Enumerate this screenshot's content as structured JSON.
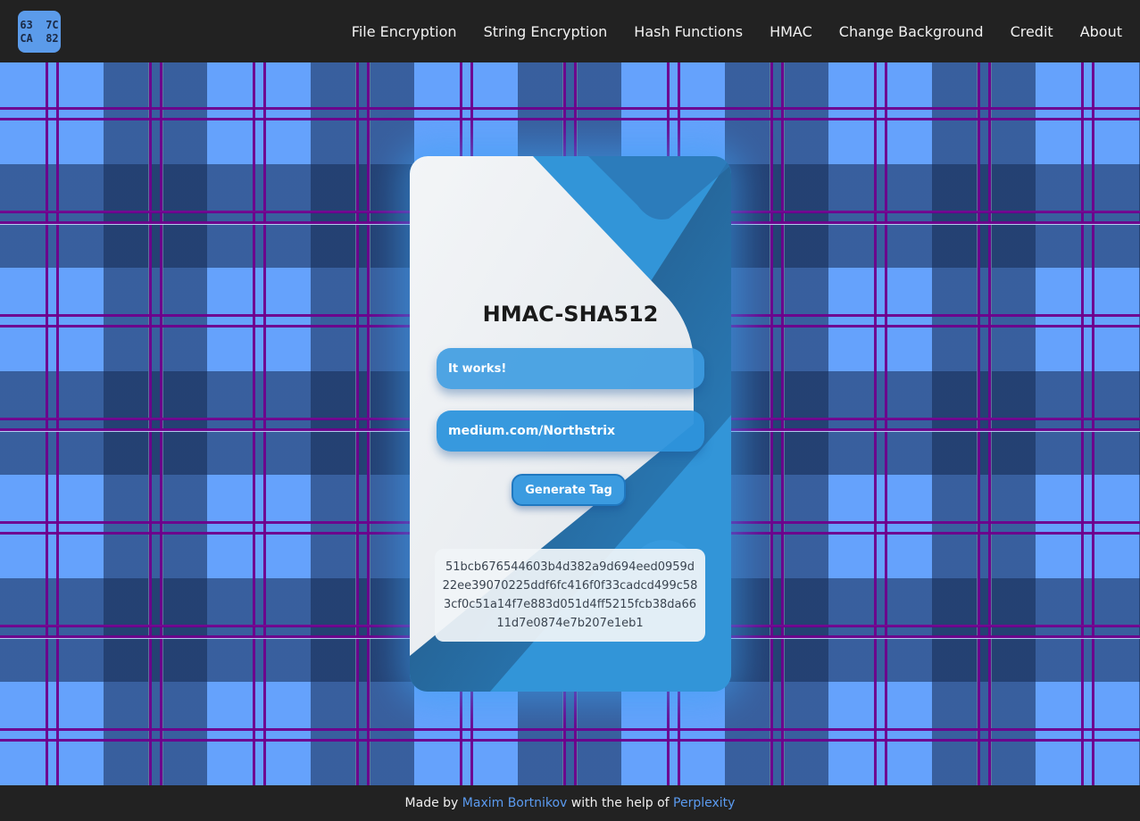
{
  "logo": {
    "line1": "63  7C",
    "line2": "CA  82"
  },
  "nav": {
    "items": [
      {
        "label": "File Encryption"
      },
      {
        "label": "String Encryption"
      },
      {
        "label": "Hash Functions"
      },
      {
        "label": "HMAC"
      },
      {
        "label": "Change Background"
      },
      {
        "label": "Credit"
      },
      {
        "label": "About"
      }
    ]
  },
  "card": {
    "title": "HMAC-SHA512",
    "message_value": "It works!",
    "key_value": "medium.com/Northstrix",
    "button_label": "Generate Tag",
    "result": "51bcb676544603b4d382a9d694eed0959d22ee39070225ddf6fc416f0f33cadcd499c583cf0c51a14f7e883d051d4ff5215fcb38da6611d7e0874e7b207e1eb1"
  },
  "footer": {
    "prefix": "Made by ",
    "author": "Maxim Bortnikov",
    "middle": " with the help of ",
    "helper": "Perplexity"
  },
  "colors": {
    "navbar": "#222222",
    "accent": "#3295d8",
    "logo_bg": "#5b9bea",
    "link": "#5b9bf0",
    "tartan_light": "#65a2fc",
    "tartan_stripe": "#6e008c"
  }
}
